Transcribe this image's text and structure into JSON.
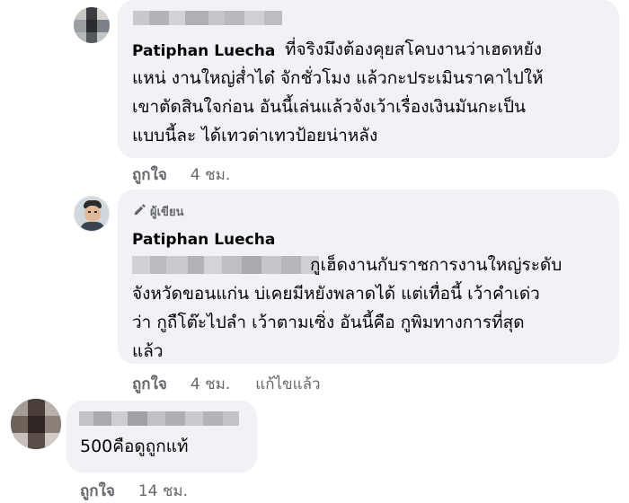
{
  "comments": [
    {
      "name_blurred": true,
      "lines": [
        "ที่จริงมึงต้องคุยสโคบงานว่าเฮดหยัง",
        "แหน่ งานใหญ่ส่ำได๋ จักชั่วโมง แล้วกะประเมินราคาไปให้",
        "เขาตัดสินใจก่อน อันนี้เล่นแล้วจังเว้าเรื่องเงินมันกะเป็น",
        "แบบนี้ละ ได้เทวด่าเทวป้อยน่าหลัง"
      ],
      "mention": "Patiphan Luecha",
      "like_label": "ถูกใจ",
      "time": "4 ชม."
    },
    {
      "author_badge": "ผู้เขียน",
      "name": "Patiphan Luecha",
      "lines": [
        "กูเฮ็ดงานกับราชการงานใหญ่ระดับ",
        "จังหวัดขอนแก่น บ่เคยมีหยังพลาดได้ แต่เทื่อนี้ เว้าคำเด่ว",
        "ว่า กูถืโต๊ะไปลำ เว้าตามเซิ่ง อันนี้คือ กูพิมทางการที่สุด",
        "แล้ว"
      ],
      "like_label": "ถูกใจ",
      "time": "4 ชม.",
      "edited_label": "แก้ไขแล้ว"
    },
    {
      "name_blurred": true,
      "lines": [
        "500คือดูถูกแท้"
      ],
      "like_label": "ถูกใจ",
      "time": "14 ชม."
    }
  ],
  "colors": {
    "bubble": "#f0f2f5",
    "secondary_text": "#65676b",
    "primary_text": "#050505"
  }
}
